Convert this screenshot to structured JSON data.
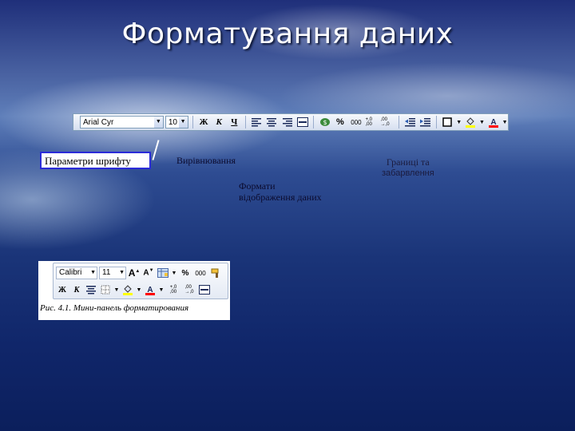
{
  "slide": {
    "title": "Форматування даних"
  },
  "toolbar": {
    "font_name": "Arial Cyr",
    "font_size": "10",
    "bold": "Ж",
    "italic": "К",
    "underline": "Ч",
    "percent": "%",
    "thousands": "000",
    "increase_decimal": "+,0 ,00",
    "decrease_decimal": ",00 →,0"
  },
  "labels": {
    "font_params": "Параметри шрифту",
    "alignment": "Вирівнювання",
    "formats_line1": "Формати",
    "formats_line2": "відображення даних",
    "borders_line1": "Границі та",
    "borders_line2": "забарвлення"
  },
  "mini_toolbar": {
    "font_name": "Calibri",
    "font_size": "11",
    "percent": "%",
    "thousands": "000",
    "bold": "Ж",
    "italic": "К",
    "caption": "Рис. 4.1. Мини-панель форматирования"
  },
  "colors": {
    "fill_color": "#ffff00",
    "font_color": "#ff0000",
    "highlight_box_border": "#2b2bd8"
  }
}
